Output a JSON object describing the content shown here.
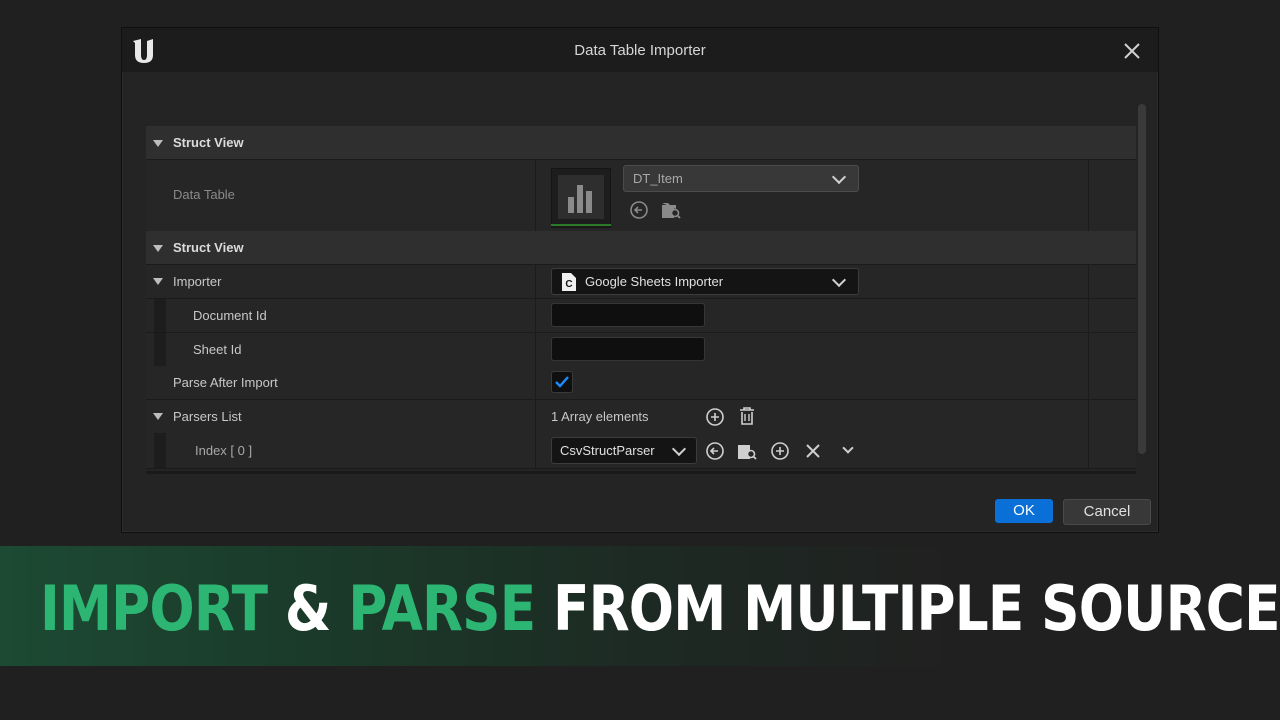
{
  "dialog": {
    "title": "Data Table Importer",
    "ok_label": "OK",
    "cancel_label": "Cancel"
  },
  "sections": {
    "struct_view_1": "Struct View",
    "struct_view_2": "Struct View"
  },
  "data_table": {
    "label": "Data Table",
    "value": "DT_Item"
  },
  "importer": {
    "label": "Importer",
    "value": "Google Sheets Importer",
    "document_id_label": "Document Id",
    "document_id_value": "",
    "sheet_id_label": "Sheet Id",
    "sheet_id_value": ""
  },
  "parse_after_import": {
    "label": "Parse After Import",
    "checked": true
  },
  "parsers_list": {
    "label": "Parsers List",
    "count_text": "1 Array elements",
    "index_label": "Index [ 0 ]",
    "index_value": "CsvStructParser"
  },
  "banner": {
    "part1": "IMPORT",
    "part2": "&",
    "part3": "PARSE",
    "part4": "FROM MULTIPLE SOURCES"
  },
  "colors": {
    "accent_green": "#2db673",
    "ok_blue": "#0a6fd6",
    "check_blue": "#1a8cff"
  }
}
